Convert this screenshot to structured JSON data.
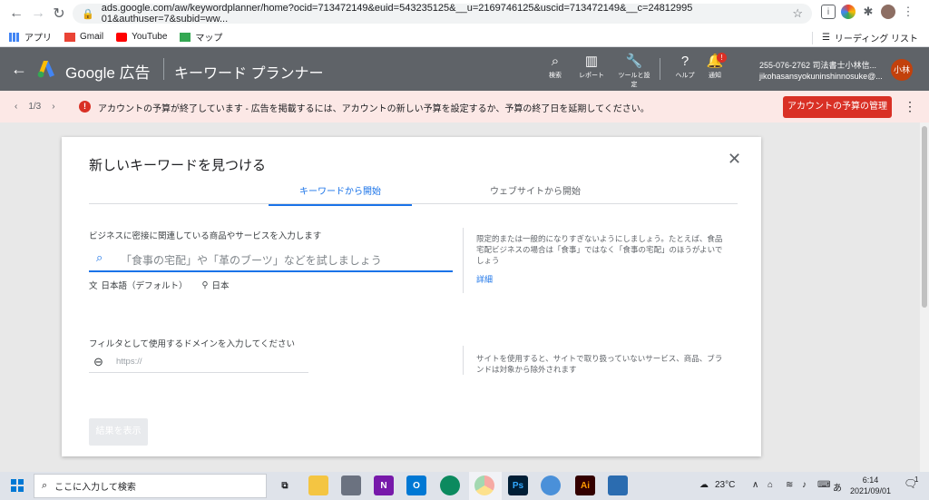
{
  "browser": {
    "url": "ads.google.com/aw/keywordplanner/home?ocid=713472149&euid=543235125&__u=2169746125&uscid=713472149&__c=24812995 01&authuser=7&subid=ww...",
    "bookmarks": [
      "アプリ",
      "Gmail",
      "YouTube",
      "マップ"
    ],
    "reading_list": "リーディング リスト"
  },
  "ads": {
    "brand": "Google 広告",
    "title": "キーワード プランナー",
    "tools": [
      "検索",
      "レポート",
      "ツールと設定",
      "ヘルプ",
      "通知"
    ],
    "notif_count": "!",
    "account_id": "255-076-2762 司法書士小林信...",
    "account_email": "jikohasansyokuninshinnosuke@...",
    "avatar": "小林",
    "accent": "#1a73e8"
  },
  "alert": {
    "pager": "1/3",
    "icon": "!",
    "text": "アカウントの予算が終了しています - 広告を掲載するには、アカウントの新しい予算を設定するか、予算の終了日を延期してください。",
    "button": "アカウントの予算の管理",
    "color": "#d93025"
  },
  "dialog": {
    "title": "新しいキーワードを見つける",
    "tabs": [
      "キーワードから開始",
      "ウェブサイトから開始"
    ],
    "product_label": "ビジネスに密接に関連している商品やサービスを入力します",
    "search_placeholder": "「食事の宅配」や「革のブーツ」などを試しましょう",
    "language": "日本語（デフォルト）",
    "location": "日本",
    "hint_keywords": "限定的または一般的になりすぎないようにしましょう。たとえば、食品宅配ビジネスの場合は「食事」ではなく「食事の宅配」のほうがよいでしょう",
    "detail_link": "詳細",
    "domain_label": "フィルタとして使用するドメインを入力してください",
    "domain_placeholder": "https://",
    "hint_domain": "サイトを使用すると、サイトで取り扱っていないサービス、商品、ブランドは対象から除外されます",
    "result_button": "結果を表示"
  },
  "taskbar": {
    "search_placeholder": "ここに入力して検索",
    "weather": "23°C",
    "ime": "あ",
    "time": "6:14",
    "date": "2021/09/01",
    "notif_count": "1"
  }
}
